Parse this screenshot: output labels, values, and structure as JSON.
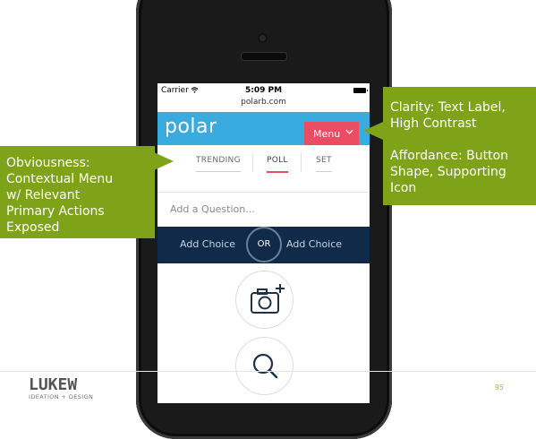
{
  "colors": {
    "callout_green": "#7ea318",
    "app_blue": "#3aabdf",
    "menu_pink": "#ea4d63",
    "choices_navy": "#112a4a"
  },
  "phone": {
    "status": {
      "carrier": "Carrier",
      "time": "5:09 PM",
      "url": "polarb.com"
    },
    "app": {
      "brand": "polar",
      "menu_label": "Menu",
      "tabs": [
        {
          "label": "TRENDING"
        },
        {
          "label": "POLL",
          "active": true
        },
        {
          "label": "SET"
        }
      ],
      "question_placeholder": "Add a Question...",
      "choice_left": "Add Choice",
      "or_label": "OR",
      "choice_right": "Add Choice",
      "actions": [
        {
          "icon": "camera-add-icon"
        },
        {
          "icon": "search-icon"
        }
      ]
    }
  },
  "callouts": {
    "left": {
      "lines": [
        "Obviousness:",
        "Contextual Menu",
        "w/ Relevant",
        "Primary Actions",
        "Exposed"
      ]
    },
    "right": {
      "para1": [
        "Clarity: Text Label,",
        "High Contrast"
      ],
      "para2": [
        "Affordance: Button",
        "Shape, Supporting",
        "Icon"
      ]
    }
  },
  "footer": {
    "logo_text_top": "LUKEW",
    "logo_text_bottom": "IDEATION + DESIGN",
    "page_number": "95"
  }
}
